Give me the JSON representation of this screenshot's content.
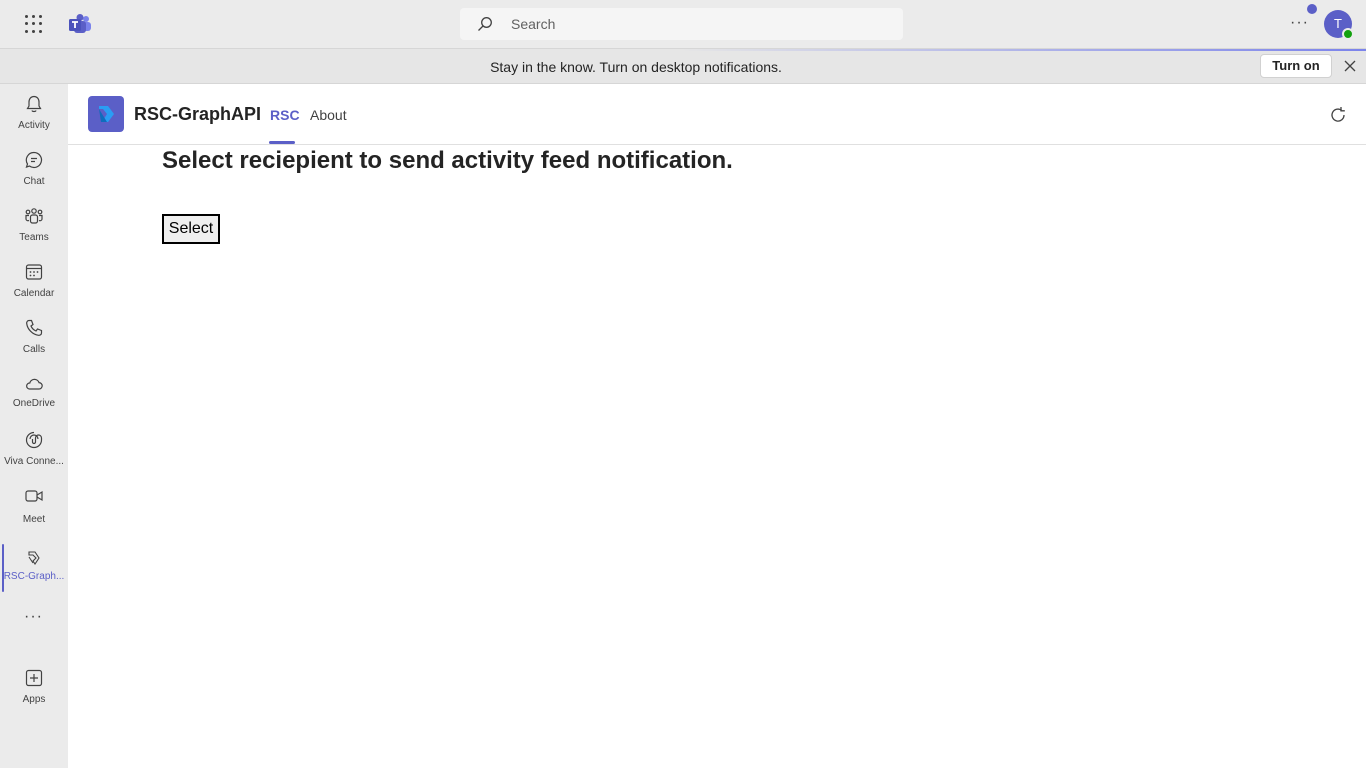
{
  "topbar": {
    "search_placeholder": "Search",
    "more_label": "···",
    "avatar_initial": "T"
  },
  "banner": {
    "text": "Stay in the know. Turn on desktop notifications.",
    "turn_on_label": "Turn on"
  },
  "rail": {
    "items": [
      {
        "label": "Activity",
        "icon": "bell-icon"
      },
      {
        "label": "Chat",
        "icon": "chat-icon"
      },
      {
        "label": "Teams",
        "icon": "teams-icon"
      },
      {
        "label": "Calendar",
        "icon": "calendar-icon"
      },
      {
        "label": "Calls",
        "icon": "phone-icon"
      },
      {
        "label": "OneDrive",
        "icon": "cloud-icon"
      },
      {
        "label": "Viva Conne...",
        "icon": "viva-connections-icon"
      },
      {
        "label": "Meet",
        "icon": "video-icon"
      },
      {
        "label": "RSC-Graph...",
        "icon": "rsc-app-icon",
        "active": true
      },
      {
        "label": "Apps",
        "icon": "add-apps-icon"
      }
    ],
    "more_label": "···"
  },
  "app": {
    "title": "RSC-GraphAPI",
    "tabs": [
      {
        "label": "RSC",
        "active": true
      },
      {
        "label": "About",
        "active": false
      }
    ]
  },
  "content": {
    "heading": "Select reciepient to send activity feed notification.",
    "select_button": "Select"
  },
  "colors": {
    "accent": "#5b5fc7",
    "presence": "#13a10e",
    "rail_bg": "#ebebeb",
    "content_bg": "#ffffff"
  }
}
